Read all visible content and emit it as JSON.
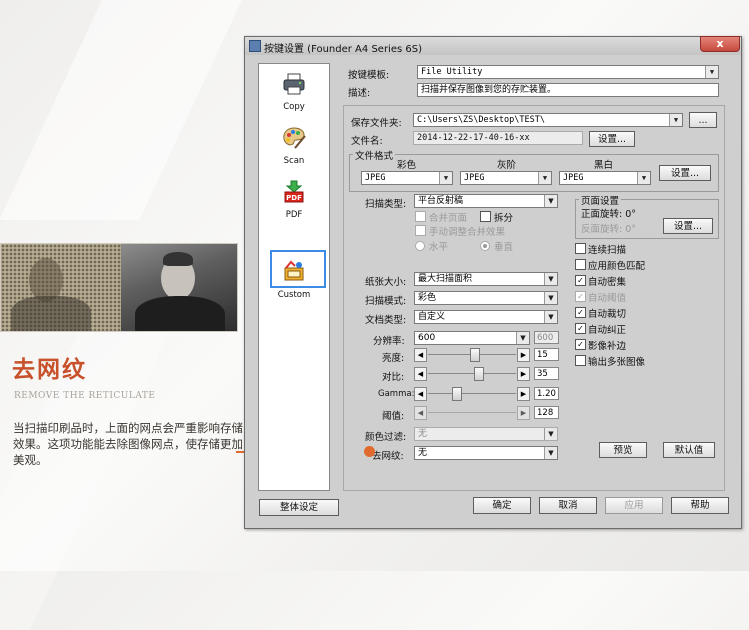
{
  "promo": {
    "title": "去网纹",
    "subtitle": "REMOVE THE RETICULATE",
    "description": "当扫描印刷品时，上面的网点会严重影响存储效果。这项功能能去除图像网点，使存储更加美观。"
  },
  "window": {
    "title": "按键设置 (Founder A4 Series 6S)",
    "close_symbol": "x"
  },
  "sidebar": {
    "items": [
      {
        "label": "Copy",
        "icon": "printer-icon"
      },
      {
        "label": "Scan",
        "icon": "palette-icon"
      },
      {
        "label": "PDF",
        "icon": "pdf-icon"
      },
      {
        "label": "Custom",
        "icon": "custom-icon",
        "selected": true
      }
    ]
  },
  "template": {
    "label": "按键模板:",
    "value": "File Utility"
  },
  "description": {
    "label": "描述:",
    "value": "扫描并保存图像到您的存贮装置。"
  },
  "save_folder": {
    "label": "保存文件夹:",
    "value": "C:\\Users\\ZS\\Desktop\\TEST\\",
    "browse_label": "..."
  },
  "file_name": {
    "label": "文件名:",
    "value": "2014-12-22-17-40-16-xx",
    "settings_label": "设置..."
  },
  "file_format": {
    "group_label": "文件格式",
    "color_label": "彩色",
    "color_value": "JPEG",
    "gray_label": "灰阶",
    "gray_value": "JPEG",
    "bw_label": "黑白",
    "bw_value": "JPEG",
    "settings_label": "设置..."
  },
  "scan_type": {
    "label": "扫描类型:",
    "value": "平台反射稿"
  },
  "merge_pages": {
    "label": "合并页面",
    "checked": false
  },
  "split": {
    "label": "拆分",
    "checked": false
  },
  "manual_merge": {
    "label": "手动调整合并效果",
    "checked": false
  },
  "orientation": {
    "horizontal_label": "水平",
    "vertical_label": "垂直",
    "selected": "垂直"
  },
  "page_settings": {
    "group_label": "页面设置",
    "front_rotation_label": "正面旋转: 0°",
    "back_rotation_label": "反面旋转: 0°",
    "settings_label": "设置..."
  },
  "options": [
    {
      "label": "连续扫描",
      "checked": false,
      "disabled": false
    },
    {
      "label": "应用颜色匹配",
      "checked": false,
      "disabled": false
    },
    {
      "label": "自动密集",
      "checked": true,
      "disabled": false
    },
    {
      "label": "自动阈值",
      "checked": true,
      "disabled": true
    },
    {
      "label": "自动裁切",
      "checked": true,
      "disabled": false
    },
    {
      "label": "自动纠正",
      "checked": true,
      "disabled": false
    },
    {
      "label": "影像补边",
      "checked": true,
      "disabled": false
    },
    {
      "label": "输出多张图像",
      "checked": false,
      "disabled": false
    }
  ],
  "paper_size": {
    "label": "纸张大小:",
    "value": "最大扫描面积"
  },
  "scan_mode": {
    "label": "扫描模式:",
    "value": "彩色"
  },
  "doc_type": {
    "label": "文档类型:",
    "value": "自定义"
  },
  "resolution": {
    "label": "分辨率:",
    "value": "600",
    "custom_value": "600"
  },
  "brightness": {
    "label": "亮度:",
    "value": "15",
    "fraction": 0.52
  },
  "contrast": {
    "label": "对比:",
    "value": "35",
    "fraction": 0.58
  },
  "gamma": {
    "label": "Gamma:",
    "value": "1.20",
    "fraction": 0.3
  },
  "threshold": {
    "label": "阈值:",
    "value": "128"
  },
  "color_filter": {
    "label": "颜色过滤:",
    "value": "无"
  },
  "descreen": {
    "label": "去网纹:",
    "value": "无"
  },
  "preview_label": "预览",
  "default_label": "默认值",
  "global_settings_label": "整体设定",
  "ok_label": "确定",
  "cancel_label": "取消",
  "apply_label": "应用",
  "help_label": "帮助",
  "colors": {
    "accent": "#c8502a",
    "callout": "#e06a2c",
    "selection": "#3c8ce6"
  }
}
